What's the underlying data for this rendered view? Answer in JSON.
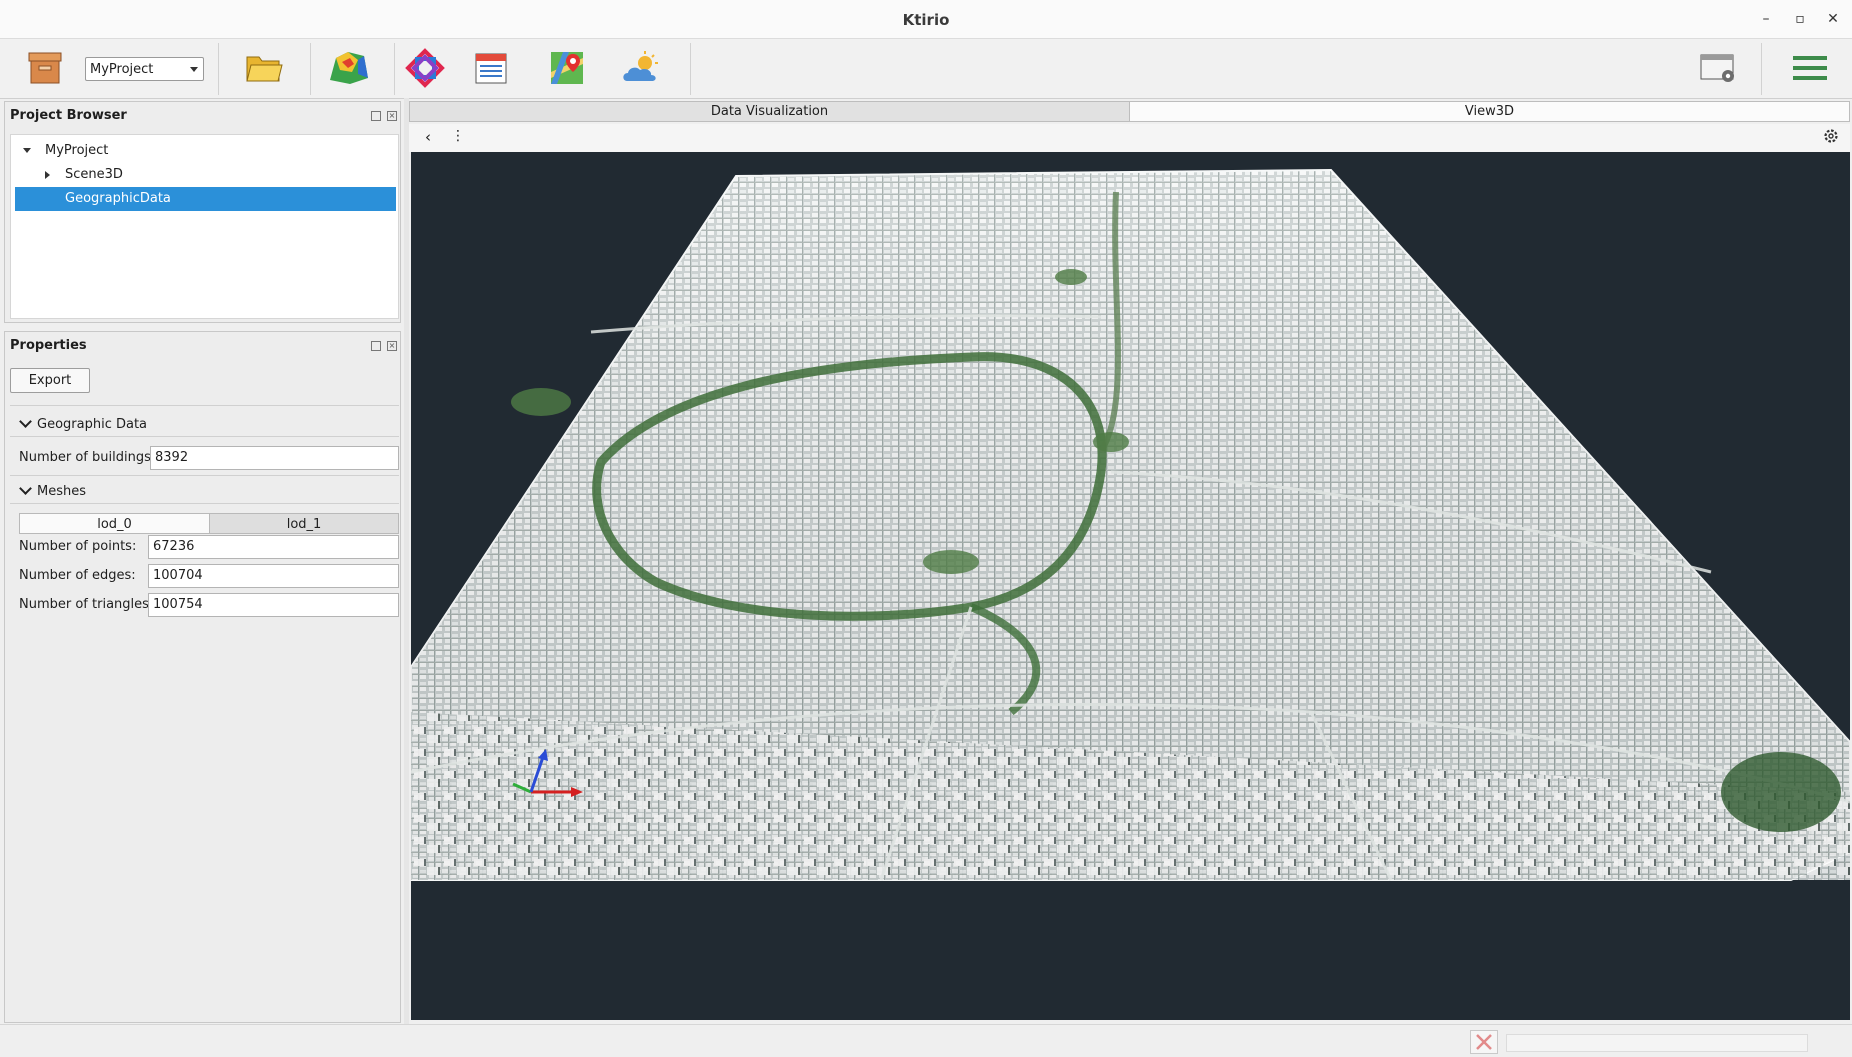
{
  "window": {
    "title": "Ktirio",
    "minimize": "–",
    "maximize": "▫",
    "close": "✕"
  },
  "toolbar": {
    "project_select_value": "MyProject",
    "icons": [
      "archive-icon",
      "folder-open-icon",
      "terrain-icon",
      "hub-logo-icon",
      "calendar-icon",
      "map-pin-icon",
      "weather-icon",
      "window-settings-icon",
      "menu-icon"
    ]
  },
  "project_browser": {
    "title": "Project Browser",
    "items": [
      {
        "label": "MyProject"
      },
      {
        "label": "Scene3D"
      },
      {
        "label": "GeographicData"
      }
    ]
  },
  "properties": {
    "title": "Properties",
    "export_label": "Export",
    "geographic_section": "Geographic Data",
    "buildings_label": "Number of buildings:",
    "buildings_value": "8392",
    "meshes_section": "Meshes",
    "lod_tabs": [
      "lod_0",
      "lod_1"
    ],
    "points_label": "Number of points:",
    "points_value": "67236",
    "edges_label": "Number of edges:",
    "edges_value": "100704",
    "triangles_label": "Number of triangles:",
    "triangles_value": "100754"
  },
  "view": {
    "tabs": [
      "Data Visualization",
      "View3D"
    ],
    "back_glyph": "‹",
    "more_glyph": "⋮"
  },
  "colors": {
    "selection": "#2b90d9",
    "viewport_bg": "#212a32",
    "axis_x": "#d42020",
    "axis_y": "#2fae3a",
    "axis_z": "#2a4cd6"
  }
}
